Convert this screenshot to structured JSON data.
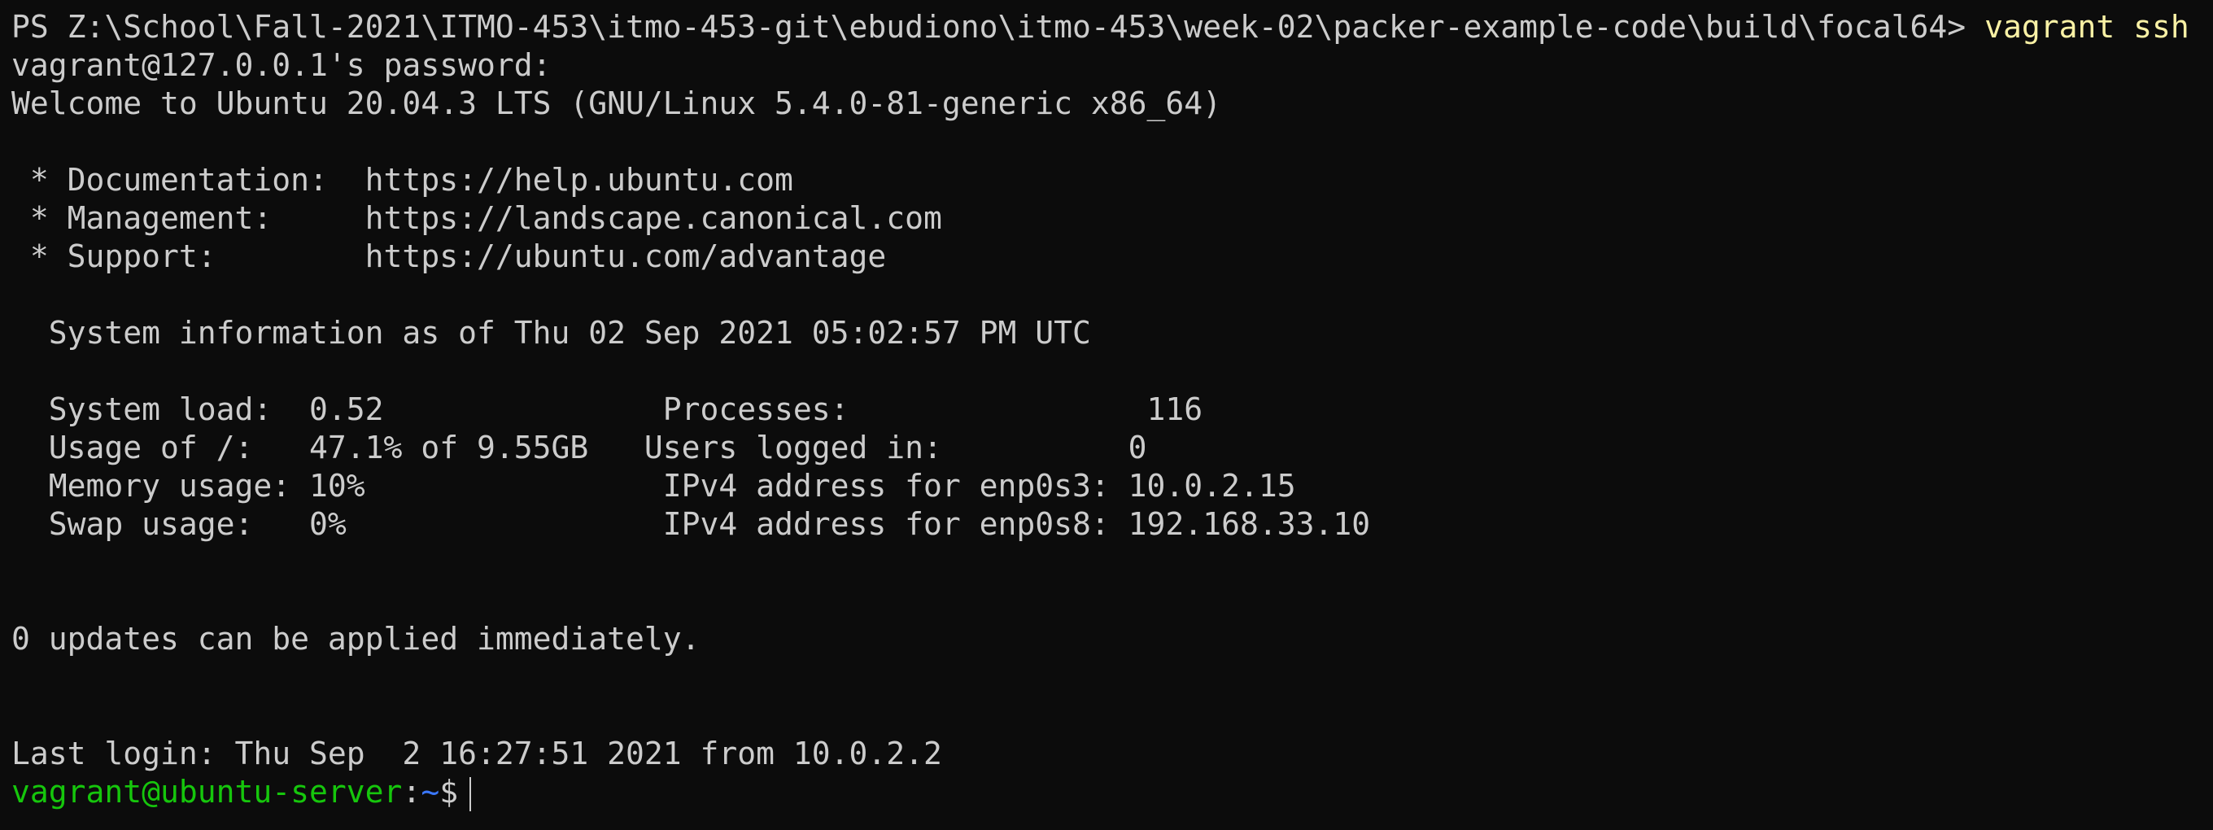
{
  "colors": {
    "background": "#0c0c0c",
    "foreground": "#cccccc",
    "command": "#f9f1a5",
    "prompt_user": "#16c60c",
    "prompt_path": "#3b78ff"
  },
  "terminal": {
    "ps_prompt": "PS Z:\\School\\Fall-2021\\ITMO-453\\itmo-453-git\\ebudiono\\itmo-453\\week-02\\packer-example-code\\build\\focal64> ",
    "ps_command": "vagrant ssh",
    "lines": [
      "vagrant@127.0.0.1's password:",
      "Welcome to Ubuntu 20.04.3 LTS (GNU/Linux 5.4.0-81-generic x86_64)",
      "",
      " * Documentation:  https://help.ubuntu.com",
      " * Management:     https://landscape.canonical.com",
      " * Support:        https://ubuntu.com/advantage",
      "",
      "  System information as of Thu 02 Sep 2021 05:02:57 PM UTC",
      "",
      "  System load:  0.52               Processes:                116",
      "  Usage of /:   47.1% of 9.55GB   Users logged in:          0",
      "  Memory usage: 10%                IPv4 address for enp0s3: 10.0.2.15",
      "  Swap usage:   0%                 IPv4 address for enp0s8: 192.168.33.10",
      "",
      "",
      "0 updates can be applied immediately.",
      "",
      "",
      "Last login: Thu Sep  2 16:27:51 2021 from 10.0.2.2"
    ],
    "bash_user": "vagrant@ubuntu-server",
    "bash_colon": ":",
    "bash_path": "~",
    "bash_symbol": "$"
  }
}
